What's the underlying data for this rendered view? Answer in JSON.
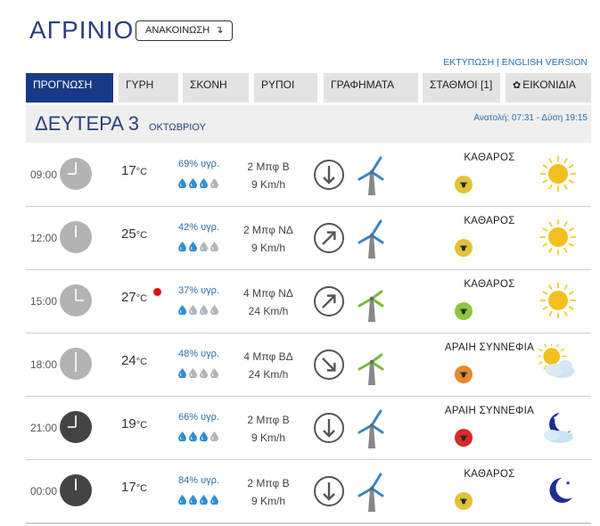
{
  "title": "ΑΓΡΙΝΙΟ",
  "announcement_label": "ΑΝΑΚΟΙΝΩΣΗ",
  "links": {
    "print": "ΕΚΤΥΠΩΣΗ",
    "sep": " | ",
    "english": "ENGLISH VERSION"
  },
  "tabs": [
    "ΠΡΟΓΝΩΣΗ",
    "ΓΥΡΗ",
    "ΣΚΟΝΗ",
    "ΡΥΠΟΙ",
    "ΓΡΑΦΗΜΑΤΑ",
    "ΣΤΑΘΜΟΙ [1]",
    "ΕΙΚΟΝΙΔΙΑ"
  ],
  "day": {
    "name": "ΔΕΥΤΕΡΑ 3",
    "month": "ΟΚΤΩΒΡΙΟΥ",
    "sun": "Ανατολή: 07:31  - Δύση 19:15"
  },
  "temp_unit": "°C",
  "colors": {
    "brand": "#183a86",
    "accent": "#2a6ea8",
    "alert": "#e11111"
  },
  "rows": [
    {
      "time": "09:00",
      "clock": "light",
      "temp": "17",
      "humidity": "69% υγρ.",
      "drops_filled": 3,
      "wind_force": "2 Μπφ Β",
      "wind_speed": "9 Km/h",
      "wind_dir": "N",
      "turbine": "blue",
      "condition": "ΚΑΘΑΡΟΣ",
      "risk_color": "#e2c23a",
      "weather_icon": "sun-icon",
      "alert": false
    },
    {
      "time": "12:00",
      "clock": "light",
      "temp": "25",
      "humidity": "42% υγρ.",
      "drops_filled": 2,
      "wind_force": "2 Μπφ ΝΔ",
      "wind_speed": "9 Km/h",
      "wind_dir": "SW",
      "turbine": "blue",
      "condition": "ΚΑΘΑΡΟΣ",
      "risk_color": "#e2c23a",
      "weather_icon": "sun-icon",
      "alert": false
    },
    {
      "time": "15:00",
      "clock": "light",
      "temp": "27",
      "humidity": "37% υγρ.",
      "drops_filled": 1,
      "wind_force": "4 Μπφ ΝΔ",
      "wind_speed": "24 Km/h",
      "wind_dir": "SW",
      "turbine": "green",
      "condition": "ΚΑΘΑΡΟΣ",
      "risk_color": "#8cc63e",
      "weather_icon": "sun-icon",
      "alert": true
    },
    {
      "time": "18:00",
      "clock": "light",
      "temp": "24",
      "humidity": "48% υγρ.",
      "drops_filled": 1,
      "wind_force": "4 Μπφ ΒΔ",
      "wind_speed": "24 Km/h",
      "wind_dir": "NW",
      "turbine": "green",
      "condition": "ΑΡΑΙΗ ΣΥΝΝΕΦΙΑ",
      "risk_color": "#e38b2c",
      "weather_icon": "sun-cloud-icon",
      "alert": false
    },
    {
      "time": "21:00",
      "clock": "dark",
      "temp": "19",
      "humidity": "66% υγρ.",
      "drops_filled": 3,
      "wind_force": "2 Μπφ Β",
      "wind_speed": "9 Km/h",
      "wind_dir": "N",
      "turbine": "blue",
      "condition": "ΑΡΑΙΗ ΣΥΝΝΕΦΙΑ",
      "risk_color": "#d62a2a",
      "weather_icon": "moon-cloud-icon",
      "alert": false
    },
    {
      "time": "00:00",
      "clock": "dark",
      "temp": "17",
      "humidity": "84% υγρ.",
      "drops_filled": 4,
      "wind_force": "2 Μπφ Β",
      "wind_speed": "9 Km/h",
      "wind_dir": "N",
      "turbine": "blue",
      "condition": "ΚΑΘΑΡΟΣ",
      "risk_color": "#e2c23a",
      "weather_icon": "moon-icon",
      "alert": false
    }
  ]
}
